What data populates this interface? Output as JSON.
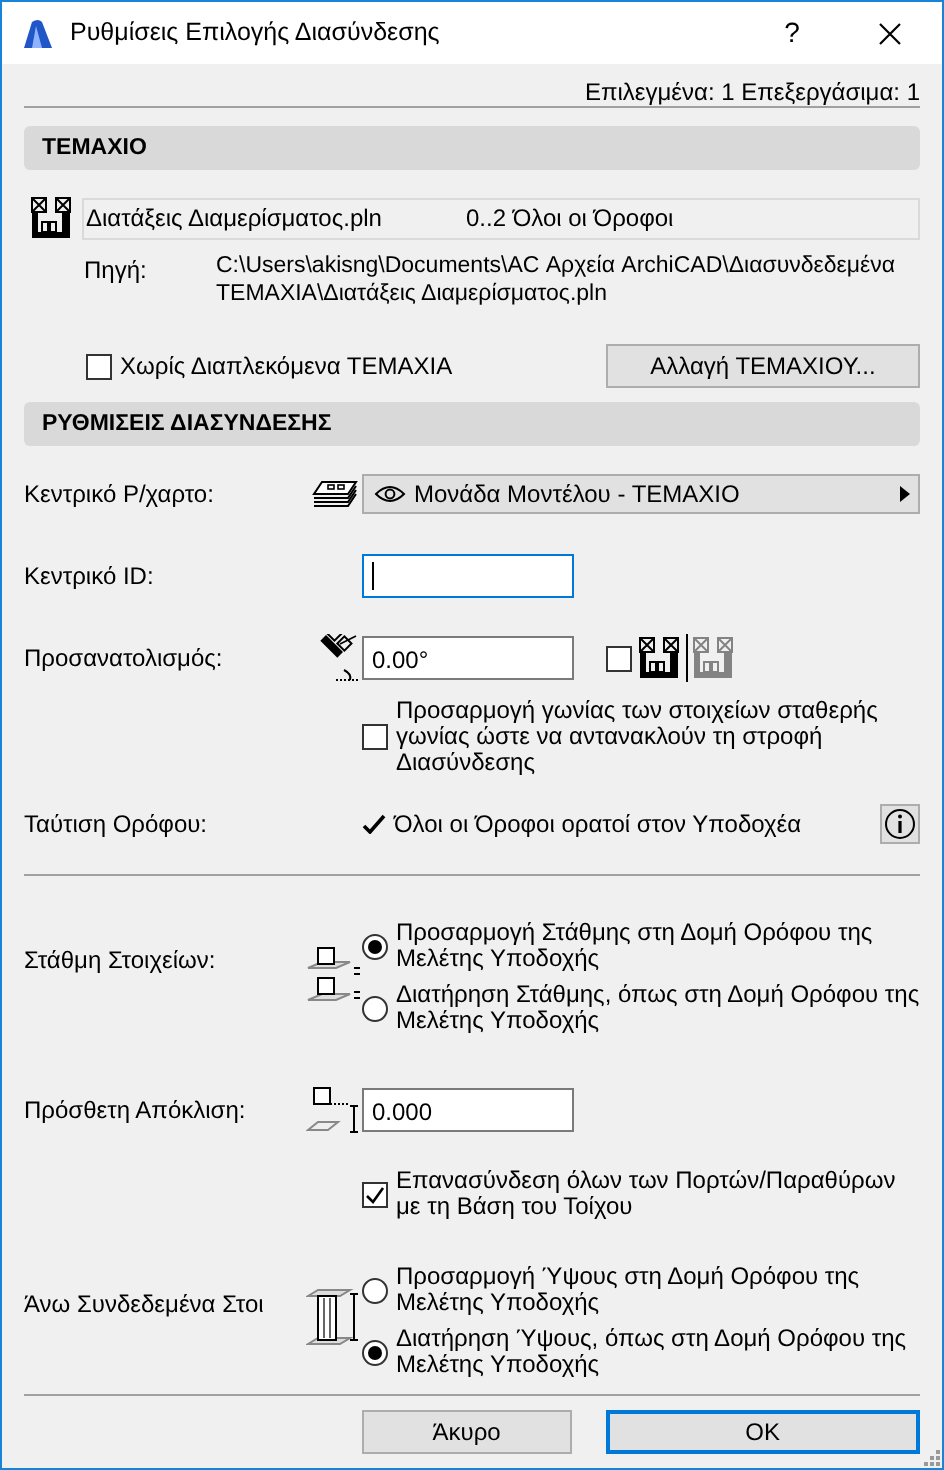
{
  "window": {
    "title": "Ρυθμίσεις Επιλογής Διασύνδεσης",
    "help_button": "?"
  },
  "selection_status": "Επιλεγμένα: 1 Επεξεργάσιμα: 1",
  "module_section": {
    "title": "ΤΕΜΑΧΙΟ",
    "file_name": "Διατάξεις Διαμερίσματος.pln",
    "stories": "0..2 Όλοι οι Όροφοι",
    "source_label": "Πηγή:",
    "source_path": "C:\\Users\\akisng\\Documents\\AC Αρχεία ArchiCAD\\Διασυνδεδεμένα ΤΕΜΑΧΙΑ\\Διατάξεις Διαμερίσματος.pln",
    "no_nested": {
      "label": "Χωρίς Διαπλεκόμενα ΤΕΜΑΧΙΑ",
      "checked": false
    },
    "change_button": "Αλλαγή ΤΕΜΑΧΙΟΥ..."
  },
  "link_section": {
    "title": "ΡΥΘΜΙΣΕΙΣ ΔΙΑΣΥΝΔΕΣΗΣ",
    "master_layout": {
      "label": "Κεντρικό Ρ/χαρτο:",
      "value": "Μονάδα Μοντέλου - ΤΕΜΑΧΙΟ"
    },
    "master_id": {
      "label": "Κεντρικό ID:",
      "focused": true
    },
    "orientation": {
      "label": "Προσανατολισμός:",
      "value": "0.00°",
      "mirror_checked": false
    },
    "adjust_angle": {
      "label": "Προσαρμογή γωνίας των στοιχείων σταθερής γωνίας ώστε να αντανακλούν τη στροφή Διασύνδεσης",
      "checked": false
    },
    "story_match": {
      "label": "Ταύτιση Ορόφου:",
      "value": "Όλοι οι Όροφοι ορατοί στον Υποδοχέα"
    }
  },
  "elevation": {
    "label": "Στάθμη Στοιχείων:",
    "options": [
      {
        "label": "Προσαρμογή Στάθμης στη Δομή Ορόφου της Μελέτης Υποδοχής",
        "selected": true
      },
      {
        "label": "Διατήρηση Στάθμης, όπως στη Δομή Ορόφου της Μελέτης Υποδοχής",
        "selected": false
      }
    ]
  },
  "offset": {
    "label": "Πρόσθετη Απόκλιση:",
    "value": "0.000"
  },
  "reconnect": {
    "label": "Επανασύνδεση όλων των Πορτών/Παραθύρων με τη Βάση του Τοίχου",
    "checked": true
  },
  "top_linked": {
    "label": "Άνω Συνδεδεμένα Στοι",
    "options": [
      {
        "label": "Προσαρμογή Ύψους στη Δομή Ορόφου της Μελέτης Υποδοχής",
        "selected": false
      },
      {
        "label": "Διατήρηση Ύψους, όπως στη Δομή Ορόφου της Μελέτης Υποδοχής",
        "selected": true
      }
    ]
  },
  "buttons": [
    {
      "label": "Άκυρο",
      "default": false
    },
    {
      "label": "OK",
      "default": true
    }
  ]
}
